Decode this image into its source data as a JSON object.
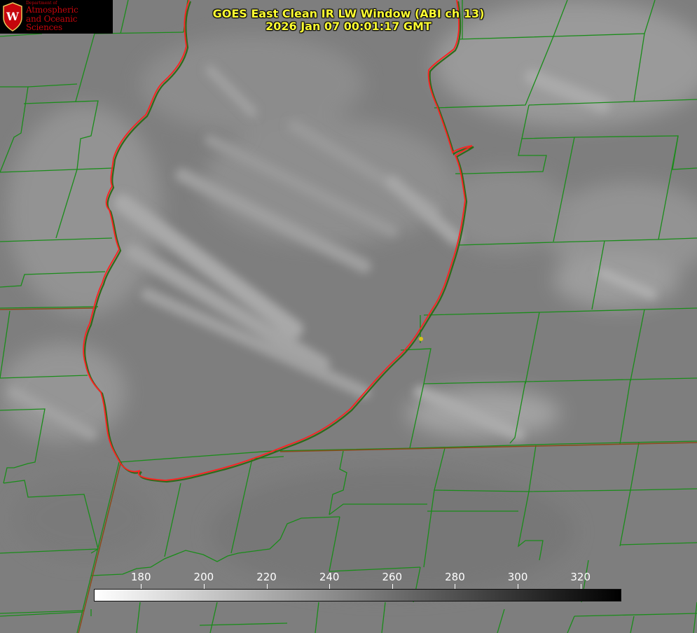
{
  "title": {
    "line1": "GOES East Clean IR LW Window (ABI ch 13)",
    "line2": "2026 Jan 07 00:01:17 GMT"
  },
  "logo": {
    "department": "Department of",
    "line1": "Atmospheric",
    "line2": "and Oceanic Sciences",
    "crest_letter": "W",
    "color": "#c5050c"
  },
  "colorbar": {
    "min": 165,
    "max": 333,
    "tick_labels": [
      "180",
      "200",
      "220",
      "240",
      "260",
      "280",
      "300",
      "320"
    ],
    "tick_values": [
      180,
      200,
      220,
      240,
      260,
      280,
      300,
      320
    ],
    "color_low": "#ffffff",
    "color_high": "#000000"
  },
  "colors": {
    "county_lines": "#1a8c1a",
    "lake_outline": "#ff2020",
    "title_text": "#ffff33",
    "marker": "#d8c21a"
  }
}
